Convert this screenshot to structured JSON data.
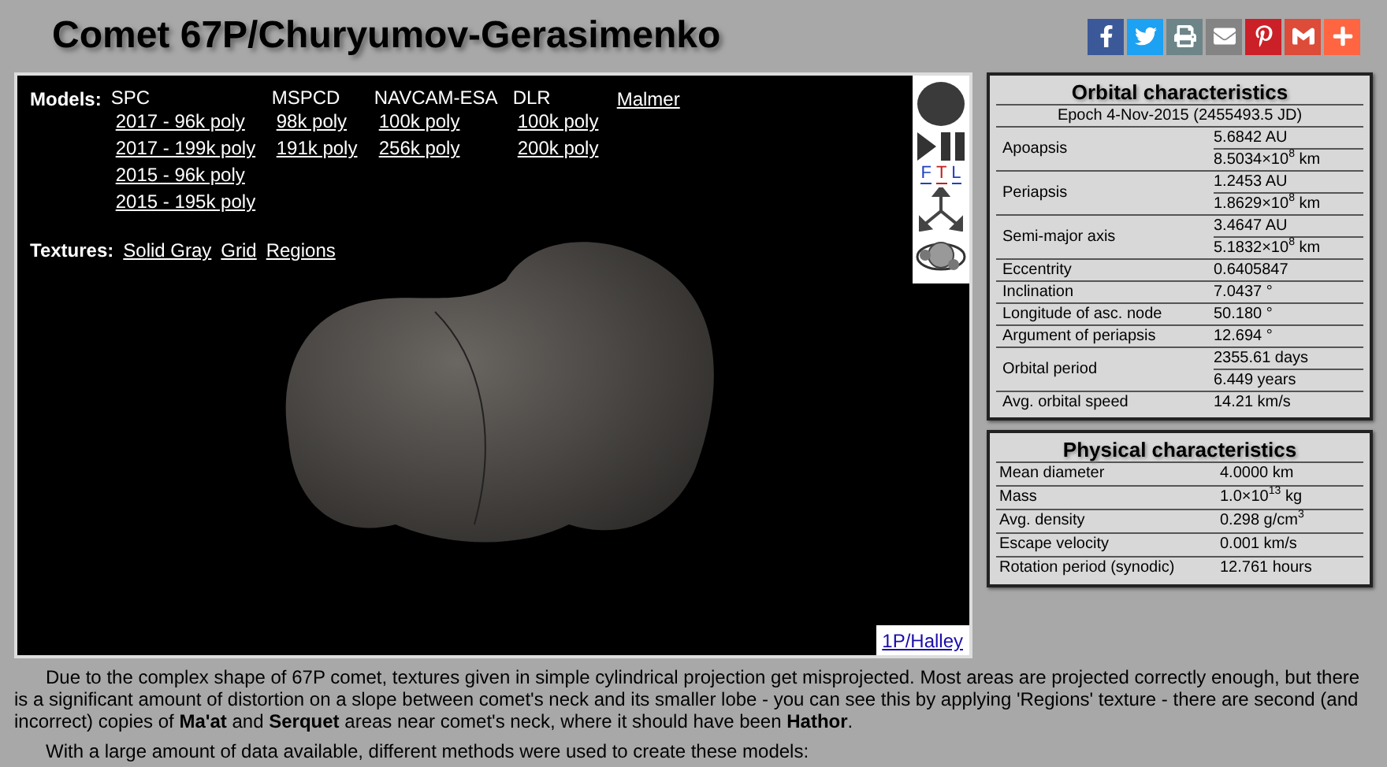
{
  "title": "Comet 67P/Churyumov-Gerasimenko",
  "share_buttons": [
    {
      "kind": "facebook",
      "color": "#3b5998"
    },
    {
      "kind": "twitter",
      "color": "#1da1f2"
    },
    {
      "kind": "print",
      "color": "#6d8589"
    },
    {
      "kind": "email",
      "color": "#848484"
    },
    {
      "kind": "pinterest",
      "color": "#cb2027"
    },
    {
      "kind": "gmail",
      "color": "#dd4b39"
    },
    {
      "kind": "more",
      "color": "#ff6540"
    }
  ],
  "viewer": {
    "models_label": "Models:",
    "model_columns": [
      {
        "kind": "group",
        "name": "SPC",
        "links": [
          "2017 - 96k poly",
          "2017 - 199k poly",
          "2015 - 96k poly",
          "2015 - 195k poly"
        ]
      },
      {
        "kind": "group",
        "name": "MSPCD",
        "links": [
          "98k poly",
          "191k poly"
        ]
      },
      {
        "kind": "group",
        "name": "NAVCAM-ESA",
        "links": [
          "100k poly",
          "256k poly"
        ]
      },
      {
        "kind": "group",
        "name": "DLR",
        "links": [
          "100k poly",
          "200k poly"
        ]
      },
      {
        "kind": "link",
        "name": "Malmer"
      }
    ],
    "textures_label": "Textures:",
    "textures": [
      "Solid Gray",
      "Grid",
      "Regions"
    ],
    "view_letters": [
      {
        "label": "F",
        "color": "#2040c0"
      },
      {
        "label": "T",
        "color": "#c02020"
      },
      {
        "label": "L",
        "color": "#2040c0"
      }
    ],
    "corner_link": "1P/Halley"
  },
  "orbital": {
    "title": "Orbital characteristics",
    "epoch": "Epoch 4-Nov-2015 (2455493.5 JD)",
    "rows": [
      {
        "label": "Apoapsis",
        "values": [
          "5.6842 AU",
          "8.5034×10$^{8}$ km"
        ]
      },
      {
        "label": "Periapsis",
        "values": [
          "1.2453 AU",
          "1.8629×10$^{8}$ km"
        ]
      },
      {
        "label": "Semi-major axis",
        "values": [
          "3.4647 AU",
          "5.1832×10$^{8}$ km"
        ]
      },
      {
        "label": "Eccentrity",
        "values": [
          "0.6405847"
        ]
      },
      {
        "label": "Inclination",
        "values": [
          "7.0437 °"
        ]
      },
      {
        "label": "Longitude of asc. node",
        "values": [
          "50.180 °"
        ]
      },
      {
        "label": "Argument of periapsis",
        "values": [
          "12.694 °"
        ]
      },
      {
        "label": "Orbital period",
        "values": [
          "2355.61 days",
          "6.449 years"
        ]
      },
      {
        "label": "Avg. orbital speed",
        "values": [
          "14.21 km/s"
        ]
      }
    ]
  },
  "physical": {
    "title": "Physical characteristics",
    "rows": [
      {
        "label": "Mean diameter",
        "value": "4.0000 km"
      },
      {
        "label": "Mass",
        "value": "1.0×10$^{13}$ kg"
      },
      {
        "label": "Avg. density",
        "value": "0.298 g/cm$^{3}$"
      },
      {
        "label": "Escape velocity",
        "value": "0.001 km/s"
      },
      {
        "label": "Rotation period (synodic)",
        "value": "12.761 hours"
      }
    ]
  },
  "paragraphs": [
    "Due to the complex shape of 67P comet, textures given in simple cylindrical projection get misprojected. Most areas are projected correctly enough, but there is a significant amount of distortion on a slope between comet's neck and its smaller lobe - you can see this by applying 'Regions' texture - there are second (and incorrect) copies of **Ma'at** and **Serquet** areas near comet's neck, where it should have been **Hathor**.",
    "With a large amount of data available, different methods were used to create these models:"
  ]
}
